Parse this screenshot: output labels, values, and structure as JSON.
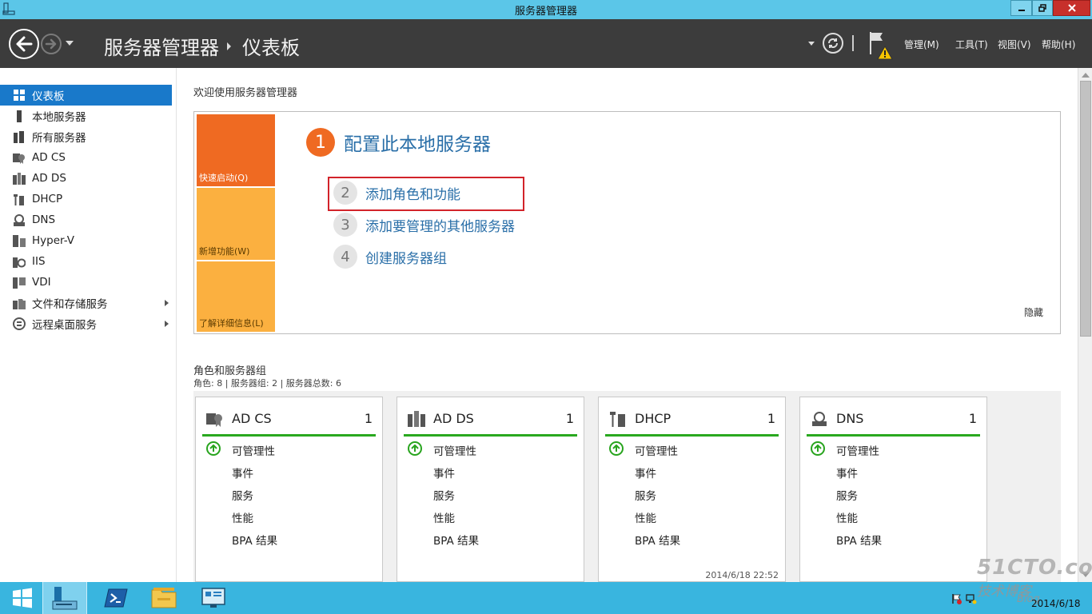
{
  "window": {
    "title": "服务器管理器"
  },
  "header": {
    "breadcrumb": [
      "服务器管理器",
      "仪表板"
    ],
    "menus": [
      "管理(M)",
      "工具(T)",
      "视图(V)",
      "帮助(H)"
    ]
  },
  "sidebar": {
    "items": [
      {
        "label": "仪表板",
        "icon": "dashboard-icon",
        "active": true
      },
      {
        "label": "本地服务器",
        "icon": "server-icon"
      },
      {
        "label": "所有服务器",
        "icon": "servers-icon"
      },
      {
        "label": "AD CS",
        "icon": "certificate-icon"
      },
      {
        "label": "AD DS",
        "icon": "directory-icon"
      },
      {
        "label": "DHCP",
        "icon": "dhcp-icon"
      },
      {
        "label": "DNS",
        "icon": "dns-icon"
      },
      {
        "label": "Hyper-V",
        "icon": "hyperv-icon"
      },
      {
        "label": "IIS",
        "icon": "iis-icon"
      },
      {
        "label": "VDI",
        "icon": "vdi-icon"
      },
      {
        "label": "文件和存储服务",
        "icon": "storage-icon",
        "expandable": true
      },
      {
        "label": "远程桌面服务",
        "icon": "remote-desktop-icon",
        "expandable": true
      }
    ]
  },
  "welcome": {
    "heading": "欢迎使用服务器管理器",
    "tiles": [
      "快速启动(Q)",
      "新增功能(W)",
      "了解详细信息(L)"
    ],
    "step1": {
      "num": "1",
      "label": "配置此本地服务器"
    },
    "steps": [
      {
        "num": "2",
        "label": "添加角色和功能"
      },
      {
        "num": "3",
        "label": "添加要管理的其他服务器"
      },
      {
        "num": "4",
        "label": "创建服务器组"
      }
    ],
    "hide": "隐藏"
  },
  "roles": {
    "title": "角色和服务器组",
    "summary": "角色: 8 | 服务器组: 2 | 服务器总数: 6",
    "rows": [
      "可管理性",
      "事件",
      "服务",
      "性能",
      "BPA 结果"
    ],
    "cards": [
      {
        "name": "AD CS",
        "count": "1",
        "icon": "certificate-icon",
        "timestamp": ""
      },
      {
        "name": "AD DS",
        "count": "1",
        "icon": "directory-icon",
        "timestamp": ""
      },
      {
        "name": "DHCP",
        "count": "1",
        "icon": "dhcp-icon",
        "timestamp": "2014/6/18 22:52"
      },
      {
        "name": "DNS",
        "count": "1",
        "icon": "dns-icon",
        "timestamp": ""
      }
    ]
  },
  "taskbar": {
    "date": "2014/6/18"
  },
  "watermark": {
    "line1": "51CTO.com",
    "line2": "技术博客",
    "line3": "Blog"
  },
  "colors": {
    "titlebar": "#5bc6e8",
    "header": "#3c3c3c",
    "accent": "#1979ca",
    "orange": "#ef6a22",
    "amber": "#fbb040",
    "link": "#2a6fa8",
    "ok_green": "#29a81f",
    "highlight_red": "#d2232a",
    "taskbar": "#39b5df"
  }
}
